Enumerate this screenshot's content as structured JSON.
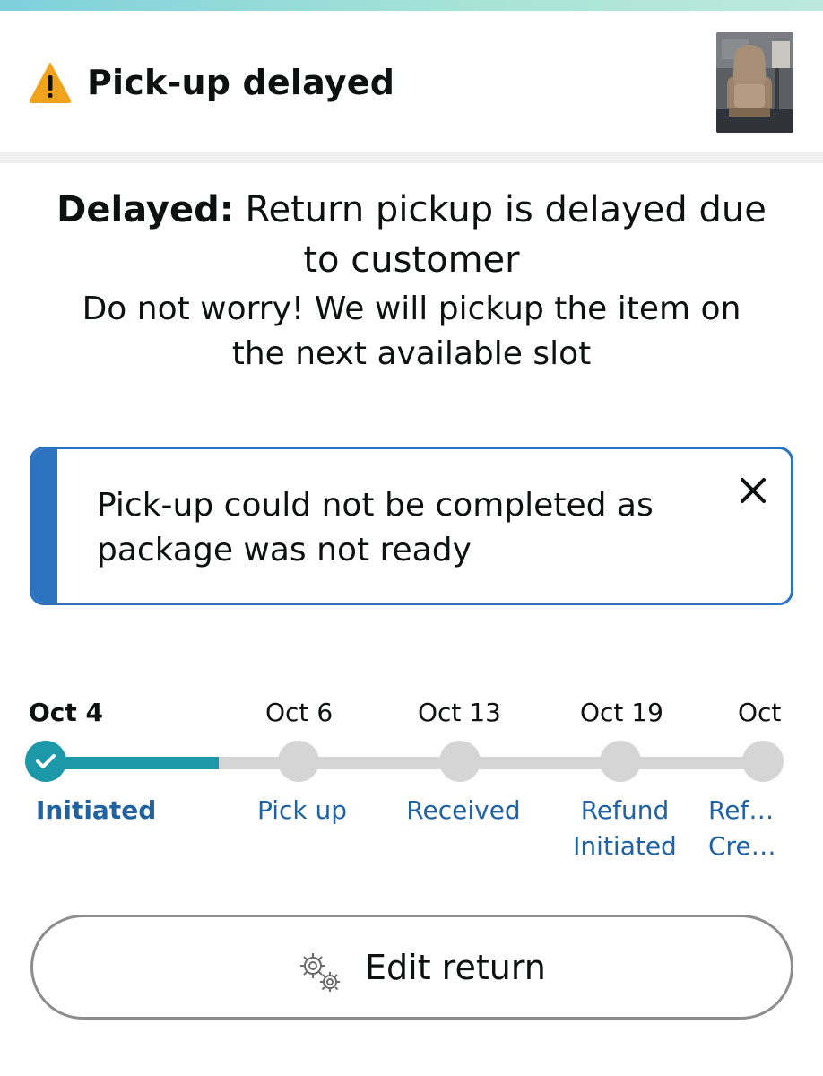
{
  "header": {
    "title": "Pick-up delayed",
    "warning_icon": "warning-triangle-icon",
    "warning_color": "#f0a41e",
    "thumbnail": "recliner-chair-product-image"
  },
  "status": {
    "bold_prefix": "Delayed:",
    "line1_rest": " Return pickup is delayed due to customer",
    "sub": "Do not worry! We will pickup the item on the next available slot"
  },
  "alert": {
    "text": "Pick-up could not be completed as package was not ready",
    "close_icon": "close-icon",
    "accent": "#2b72c0"
  },
  "tracker": {
    "progress_fraction": 0.25,
    "accent": "#1d98a8",
    "steps": [
      {
        "date": "Oct 4",
        "label": "Initiated",
        "done": true
      },
      {
        "date": "Oct 6",
        "label": "Pick up",
        "done": false
      },
      {
        "date": "Oct 13",
        "label": "Received",
        "done": false
      },
      {
        "date": "Oct 19",
        "label": "Refund Initiated",
        "done": false
      },
      {
        "date": "Oct",
        "label": "Ref… Cre…",
        "done": false
      }
    ]
  },
  "edit_button": {
    "label": "Edit return",
    "icon": "gears-icon"
  }
}
